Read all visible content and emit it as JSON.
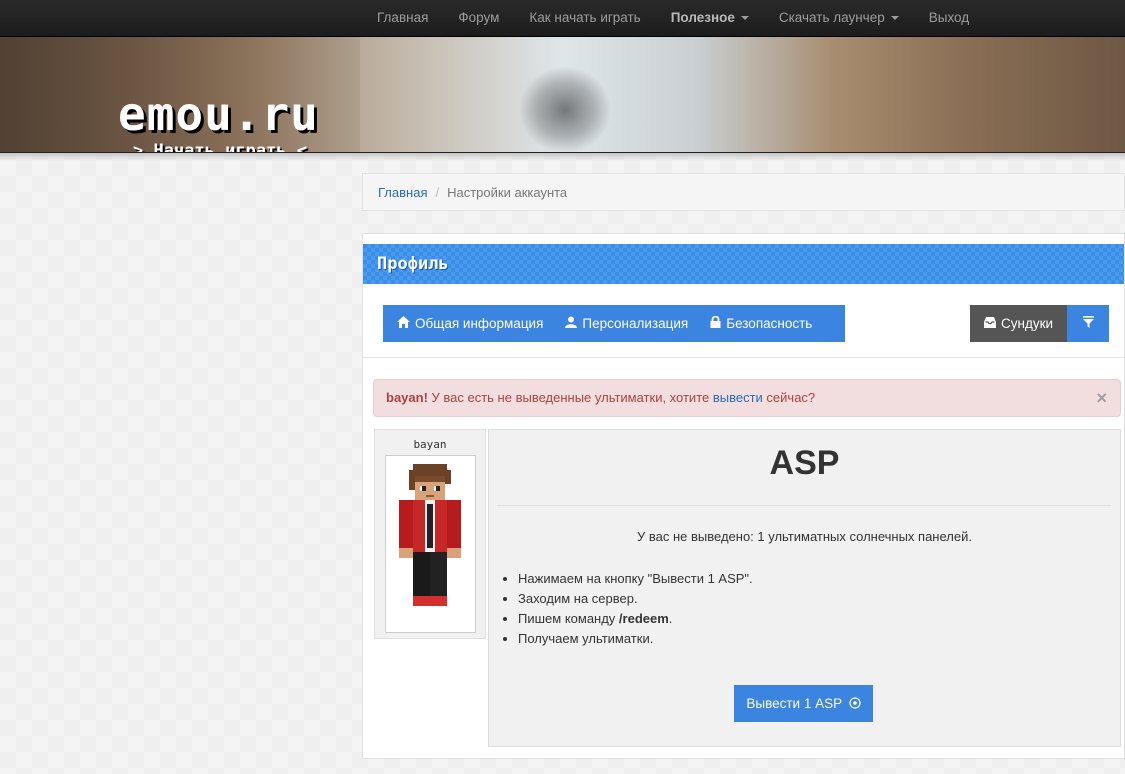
{
  "nav": {
    "items": [
      {
        "label": "Главная",
        "bold": false,
        "dropdown": false
      },
      {
        "label": "Форум",
        "bold": false,
        "dropdown": false
      },
      {
        "label": "Как начать играть",
        "bold": false,
        "dropdown": false
      },
      {
        "label": "Полезное",
        "bold": true,
        "dropdown": true
      },
      {
        "label": "Скачать лаунчер",
        "bold": false,
        "dropdown": true
      },
      {
        "label": "Выход",
        "bold": false,
        "dropdown": false
      }
    ]
  },
  "banner": {
    "logo": "emou.ru",
    "play_link": "> Начать играть <"
  },
  "breadcrumb": {
    "home": "Главная",
    "separator": "/",
    "current": "Настройки аккаунта"
  },
  "panel": {
    "title": "Профиль",
    "tabs": [
      {
        "label": "Общая информация",
        "icon": "home-icon"
      },
      {
        "label": "Персонализация",
        "icon": "user-icon"
      },
      {
        "label": "Безопасность",
        "icon": "lock-icon"
      }
    ],
    "chests_label": "Сундуки",
    "chests_icon": "inbox-icon",
    "filter_icon": "filter-icon"
  },
  "alert": {
    "username": "bayan!",
    "text_before": " У вас есть не выведенные ультиматки, хотите ",
    "link": "вывести",
    "text_after": " сейчас?",
    "close": "×"
  },
  "skin": {
    "name": "bayan"
  },
  "asp": {
    "title": "ASP",
    "info": "У вас не выведено: 1 ультиматных солнечных панелей.",
    "steps": [
      {
        "text": "Нажимаем на кнопку \"Вывести 1 ASP\".",
        "bold": ""
      },
      {
        "text": "Заходим на сервер.",
        "bold": ""
      },
      {
        "text": "Пишем команду ",
        "bold": "/redeem",
        "after": "."
      },
      {
        "text": "Получаем ультиматки.",
        "bold": ""
      }
    ],
    "button_label": "Вывести 1 ASP"
  },
  "colors": {
    "accent": "#3b84e0",
    "navbar": "#222222",
    "alert_bg": "#f2dede",
    "alert_text": "#a94442"
  }
}
